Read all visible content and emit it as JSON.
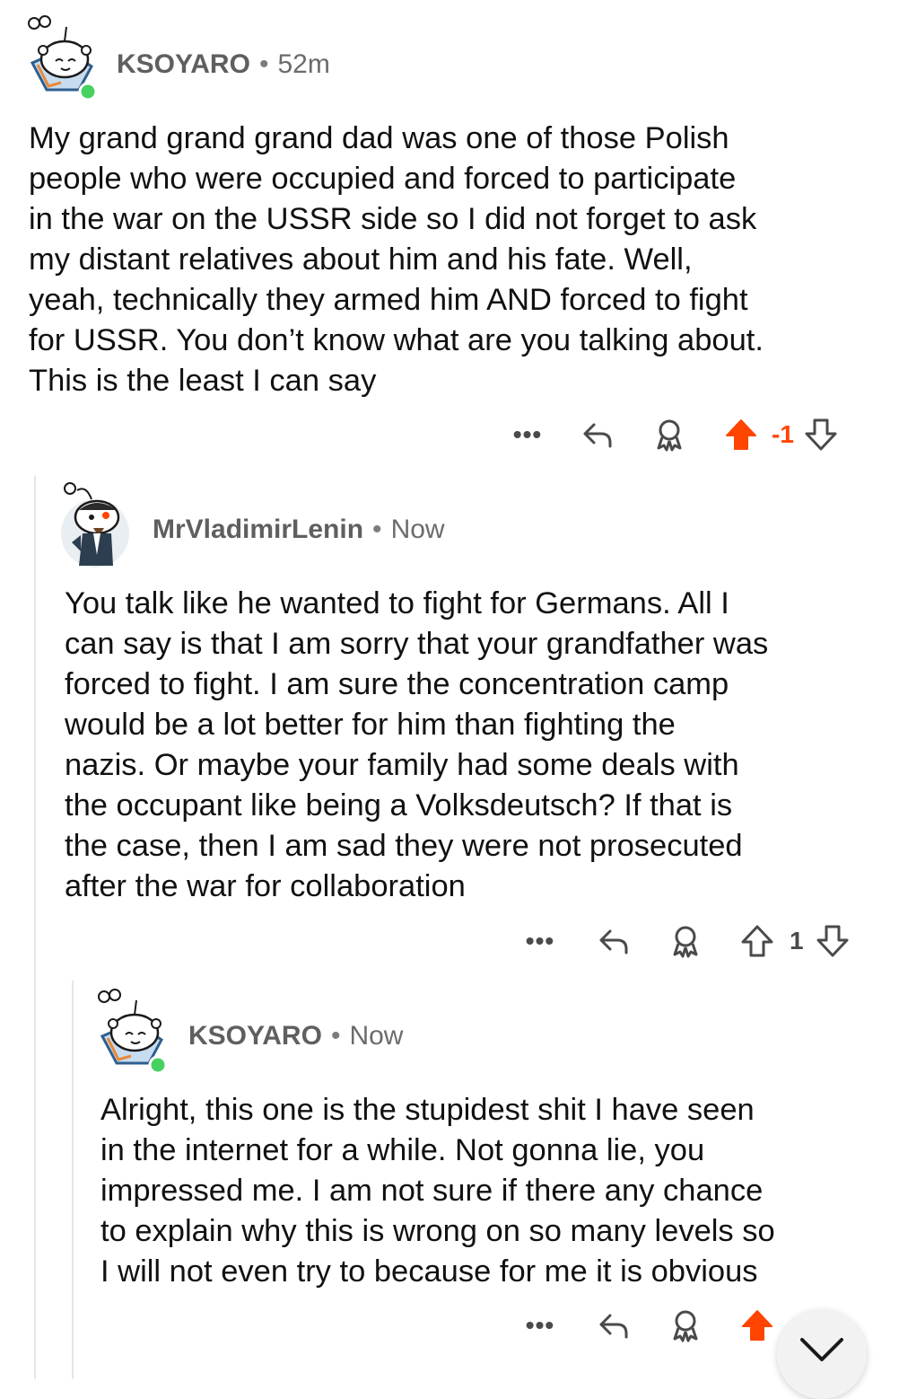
{
  "comments": [
    {
      "username": "KSOYARO",
      "separator": "•",
      "time": "52m",
      "body": "My grand grand  grand dad was one of those Polish\npeople who were occupied and forced to participate\nin the war on the USSR side so I did not forget to ask\nmy distant relatives about him and his fate. Well,\nyeah, technically they armed him AND forced to fight\nfor USSR. You don’t know what are you talking about.\nThis is the least I can say",
      "vote_count": "-1",
      "upvoted": true,
      "more_label": "•••"
    },
    {
      "username": "MrVladimirLenin",
      "separator": "•",
      "time": "Now",
      "body": "You talk like he wanted to fight for Germans. All I\ncan say is that I am sorry that your grandfather was\nforced to fight. I am sure the concentration camp\nwould be a lot better for him than fighting the\nnazis. Or maybe your family had some deals with\nthe occupant like being a Volksdeutsch? If that is\nthe case, then I am sad they were not prosecuted\nafter the war for collaboration",
      "vote_count": "1",
      "upvoted": false,
      "more_label": "•••"
    },
    {
      "username": "KSOYARO",
      "separator": "•",
      "time": "Now",
      "body": "Alright, this one is the stupidest shit I have seen\nin the internet for a while. Not gonna lie, you\nimpressed me. I am not sure if there any chance\nto explain why this is wrong on so many levels so\nI will not even try to because for me it is obvious",
      "vote_count": "",
      "upvoted": true,
      "more_label": "•••"
    }
  ],
  "colors": {
    "upvote": "#ff4500",
    "icon": "#4a4a4a",
    "online": "#46d160",
    "thread_line": "#e6e6e6"
  },
  "icons": {
    "more": "more-dots-icon",
    "reply": "reply-arrow-icon",
    "award": "award-icon",
    "upvote": "upvote-arrow-icon",
    "downvote": "downvote-arrow-icon",
    "scroll": "chevron-down-icon"
  }
}
